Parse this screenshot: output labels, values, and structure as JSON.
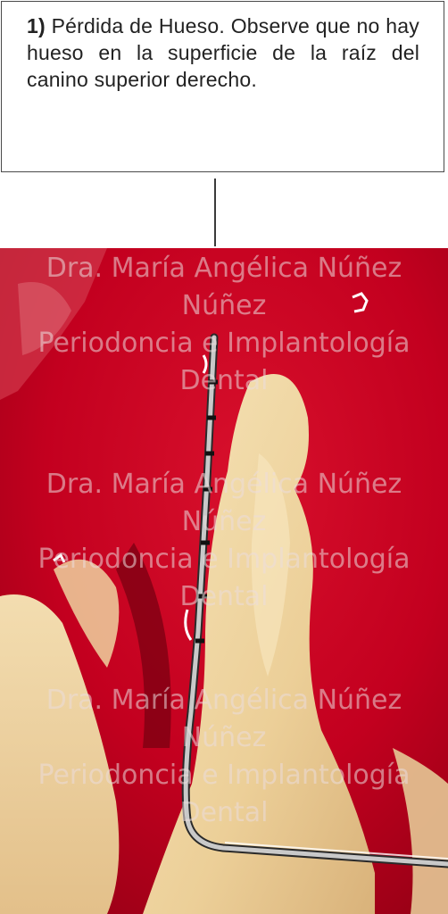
{
  "caption": {
    "number": "1)",
    "text": " Pérdida de Hueso. Observe que no hay hueso en la superficie de la raíz del canino superior derecho."
  },
  "photo": {
    "watermark": {
      "line1": "Dra. María Angélica Núñez",
      "line2": "Núñez",
      "line3": "Periodoncia e Implantología",
      "line4": "Dental"
    },
    "colors": {
      "gum": "#c3001f",
      "gum_dark": "#8e0015",
      "tooth": "#f0d9a8",
      "probe": "#c9c9c9"
    }
  }
}
